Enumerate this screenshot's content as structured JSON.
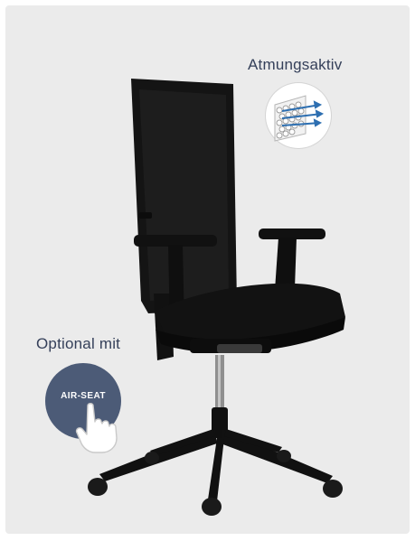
{
  "labels": {
    "breathable": "Atmungsaktiv",
    "optional": "Optional mit",
    "air_seat": "AIR-SEAT"
  },
  "icons": {
    "mesh": "breathable-mesh-icon",
    "hand": "pointing-hand-icon"
  },
  "colors": {
    "background": "#ebebeb",
    "text": "#35405a",
    "button": "#4c5b77",
    "arrows": "#2d6fb1",
    "chair": "#141414"
  }
}
